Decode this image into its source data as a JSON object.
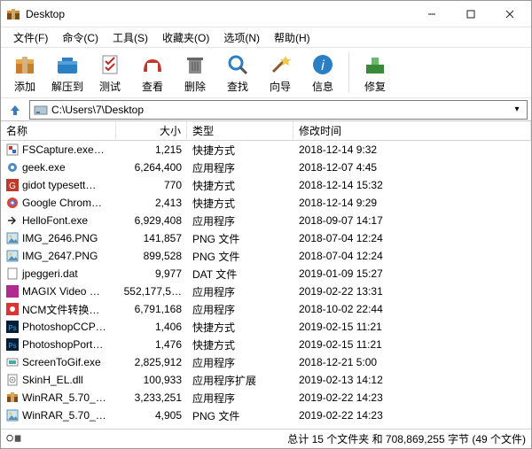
{
  "window": {
    "title": "Desktop"
  },
  "menu": [
    "文件(F)",
    "命令(C)",
    "工具(S)",
    "收藏夹(O)",
    "选项(N)",
    "帮助(H)"
  ],
  "toolbar": {
    "add": "添加",
    "extract": "解压到",
    "test": "测试",
    "view": "查看",
    "delete": "删除",
    "find": "查找",
    "wizard": "向导",
    "info": "信息",
    "repair": "修复"
  },
  "address": {
    "path": "C:\\Users\\7\\Desktop"
  },
  "columns": {
    "name": "名称",
    "size": "大小",
    "type": "类型",
    "modified": "修改时间"
  },
  "files": [
    {
      "icon": "fsc",
      "name": "FSCapture.exe…",
      "size": "1,215",
      "type": "快捷方式",
      "mod": "2018-12-14 9:32"
    },
    {
      "icon": "gear",
      "name": "geek.exe",
      "size": "6,264,400",
      "type": "应用程序",
      "mod": "2018-12-07 4:45"
    },
    {
      "icon": "gi",
      "name": "gidot typesett…",
      "size": "770",
      "type": "快捷方式",
      "mod": "2018-12-14 15:32"
    },
    {
      "icon": "chrome",
      "name": "Google Chrom…",
      "size": "2,413",
      "type": "快捷方式",
      "mod": "2018-12-14 9:29"
    },
    {
      "icon": "arrow",
      "name": "HelloFont.exe",
      "size": "6,929,408",
      "type": "应用程序",
      "mod": "2018-09-07 14:17"
    },
    {
      "icon": "png",
      "name": "IMG_2646.PNG",
      "size": "141,857",
      "type": "PNG 文件",
      "mod": "2018-07-04 12:24"
    },
    {
      "icon": "png",
      "name": "IMG_2647.PNG",
      "size": "899,528",
      "type": "PNG 文件",
      "mod": "2018-07-04 12:24"
    },
    {
      "icon": "dat",
      "name": "jpeggeri.dat",
      "size": "9,977",
      "type": "DAT 文件",
      "mod": "2019-01-09 15:27"
    },
    {
      "icon": "magix",
      "name": "MAGIX Video …",
      "size": "552,177,5…",
      "type": "应用程序",
      "mod": "2019-02-22 13:31"
    },
    {
      "icon": "ncm",
      "name": "NCM文件转换…",
      "size": "6,791,168",
      "type": "应用程序",
      "mod": "2018-10-02 22:44"
    },
    {
      "icon": "ps",
      "name": "PhotoshopCCP…",
      "size": "1,406",
      "type": "快捷方式",
      "mod": "2019-02-15 11:21"
    },
    {
      "icon": "ps",
      "name": "PhotoshopPort…",
      "size": "1,476",
      "type": "快捷方式",
      "mod": "2019-02-15 11:21"
    },
    {
      "icon": "stg",
      "name": "ScreenToGif.exe",
      "size": "2,825,912",
      "type": "应用程序",
      "mod": "2018-12-21 5:00"
    },
    {
      "icon": "dll",
      "name": "SkinH_EL.dll",
      "size": "100,933",
      "type": "应用程序扩展",
      "mod": "2019-02-13 14:12"
    },
    {
      "icon": "rar",
      "name": "WinRAR_5.70_…",
      "size": "3,233,251",
      "type": "应用程序",
      "mod": "2019-02-22 14:23"
    },
    {
      "icon": "png",
      "name": "WinRAR_5.70_…",
      "size": "4,905",
      "type": "PNG 文件",
      "mod": "2019-02-22 14:23"
    }
  ],
  "status": {
    "summary": "总计 15 个文件夹 和 708,869,255 字节 (49 个文件)"
  }
}
